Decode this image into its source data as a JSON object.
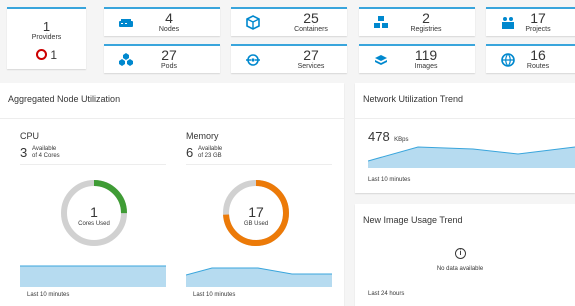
{
  "providers": {
    "count": "1",
    "label": "Providers",
    "error_count": "1"
  },
  "tiles": [
    {
      "value": "4",
      "label": "Nodes",
      "icon": "server-icon"
    },
    {
      "value": "25",
      "label": "Containers",
      "icon": "cube-icon"
    },
    {
      "value": "2",
      "label": "Registries",
      "icon": "registry-icon"
    },
    {
      "value": "17",
      "label": "Projects",
      "icon": "users-icon"
    },
    {
      "value": "27",
      "label": "Pods",
      "icon": "cubes-icon"
    },
    {
      "value": "27",
      "label": "Services",
      "icon": "service-icon"
    },
    {
      "value": "119",
      "label": "Images",
      "icon": "image-icon"
    },
    {
      "value": "16",
      "label": "Routes",
      "icon": "route-icon"
    }
  ],
  "node_utilization": {
    "title": "Aggregated Node Utilization",
    "cpu": {
      "title": "CPU",
      "available_num": "3",
      "available_word": "Available",
      "available_of": "of 4 Cores",
      "used_value": "1",
      "used_label": "Cores Used",
      "used_fraction": 0.25,
      "color": "#3f9c35",
      "footer": "Last 10 minutes"
    },
    "memory": {
      "title": "Memory",
      "available_num": "6",
      "available_word": "Available",
      "available_of": "of 23 GB",
      "used_value": "17",
      "used_label": "GB Used",
      "used_fraction": 0.74,
      "color": "#ec7a08",
      "footer": "Last 10 minutes"
    }
  },
  "network": {
    "title": "Network Utilization Trend",
    "value": "478",
    "unit": "KBps",
    "footer": "Last 10 minutes"
  },
  "image_usage": {
    "title": "New Image Usage Trend",
    "empty_text": "No data available",
    "icon": "info-icon",
    "footer": "Last 24 hours"
  },
  "colors": {
    "accent": "#39a5dc",
    "chart_fill": "#b6dbf0",
    "chart_line": "#39a5dc",
    "error": "#cc0000"
  }
}
